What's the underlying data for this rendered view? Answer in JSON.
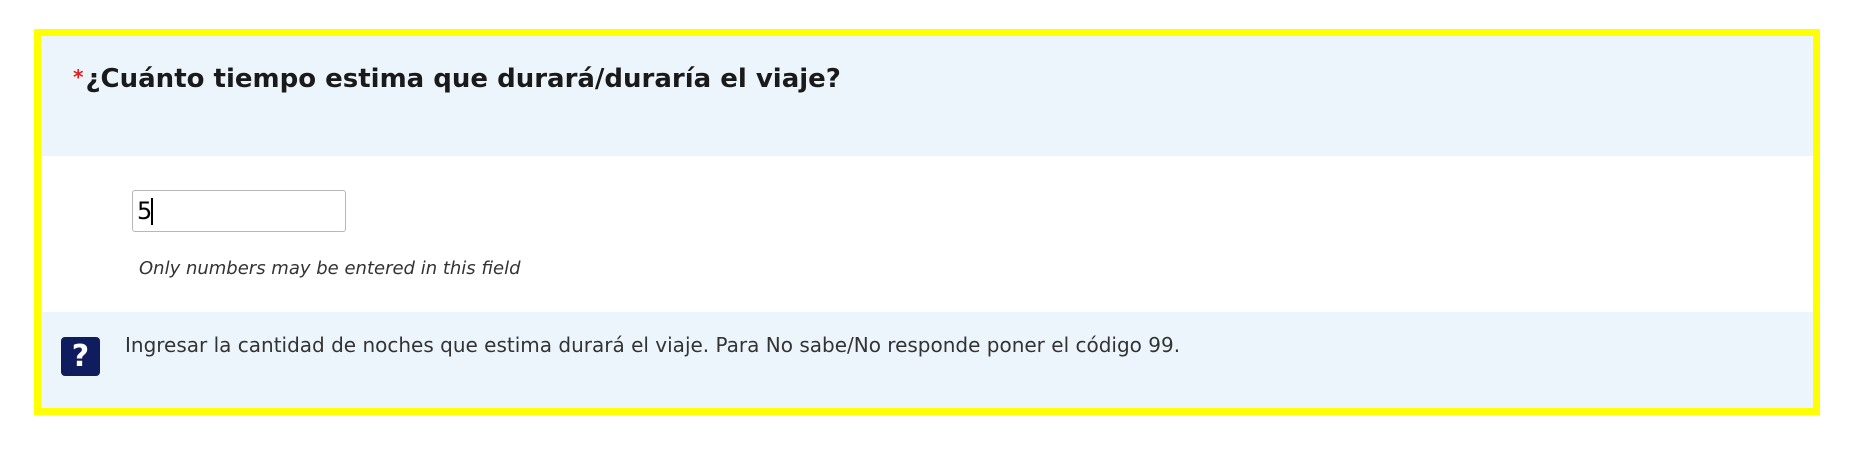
{
  "question": {
    "required_marker": "*",
    "title": "¿Cuánto tiempo estima que durará/duraría el viaje?"
  },
  "answer": {
    "value": "5",
    "validation_hint": "Only numbers may be entered in this field"
  },
  "help": {
    "icon_glyph": "?",
    "icon_name": "help-icon",
    "text": "Ingresar la cantidad de noches que estima durará el viaje. Para No sabe/No responde poner el código 99."
  },
  "colors": {
    "frame_highlight": "#ffff00",
    "header_background": "#edf5fc",
    "required_star": "#e02020",
    "help_icon_background": "#0f1c5e"
  }
}
